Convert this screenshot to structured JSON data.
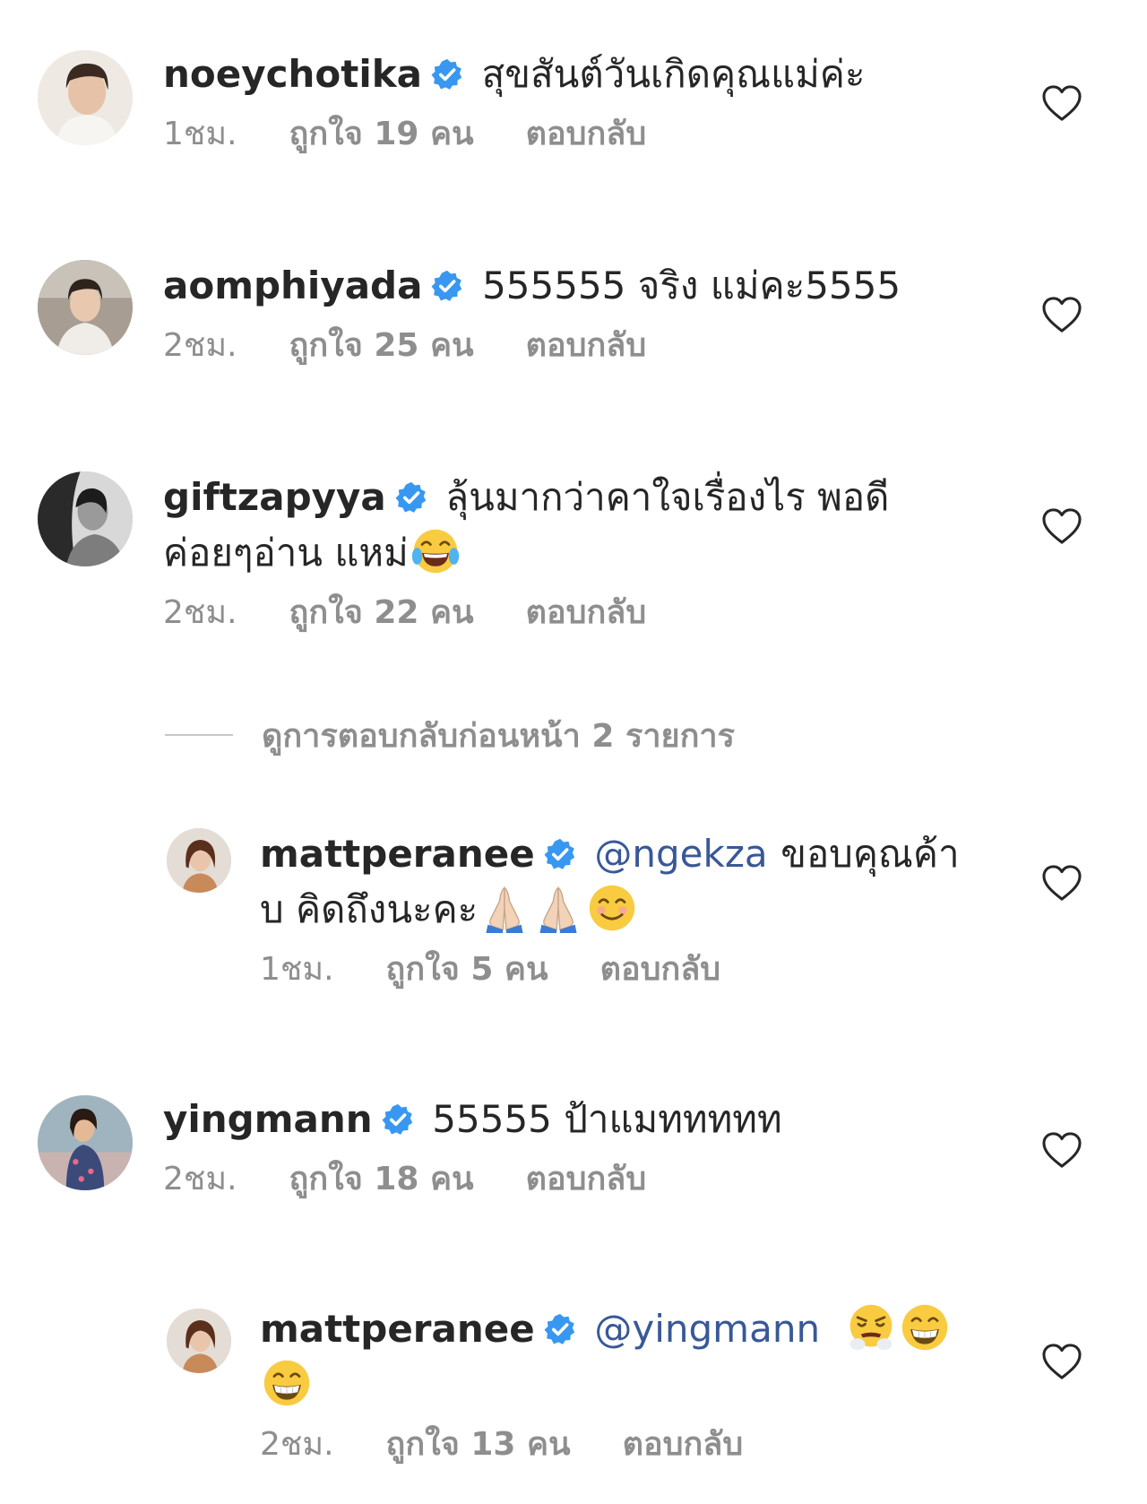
{
  "comments": [
    {
      "username": "noeychotika",
      "line1": "สุขสันต์วันเกิดคุณแม่ค่ะ",
      "time": "1ชม.",
      "likes": "ถูกใจ 19 คน",
      "reply": "ตอบกลับ"
    },
    {
      "username": "aomphiyada",
      "line1": "555555 จริง แม่คะ5555",
      "time": "2ชม.",
      "likes": "ถูกใจ 25 คน",
      "reply": "ตอบกลับ"
    },
    {
      "username": "giftzapyya",
      "line1": "ลุ้นมากว่าคาใจเรื่องไร พอดี",
      "line2": "ค่อยๆอ่าน แหม่",
      "time": "2ชม.",
      "likes": "ถูกใจ 22 คน",
      "reply": "ตอบกลับ"
    },
    {
      "username": "mattperanee",
      "mention": "@ngekza",
      "line1": "ขอบคุณค้า",
      "line2": "บ คิดถึงนะคะ",
      "time": "1ชม.",
      "likes": "ถูกใจ 5 คน",
      "reply": "ตอบกลับ"
    },
    {
      "username": "yingmann",
      "line1": "55555 ป้าแมททททท",
      "time": "2ชม.",
      "likes": "ถูกใจ 18 คน",
      "reply": "ตอบกลับ"
    },
    {
      "username": "mattperanee",
      "mention": "@yingmann",
      "time": "2ชม.",
      "likes": "ถูกใจ 13 คน",
      "reply": "ตอบกลับ"
    }
  ],
  "view_previous_replies": "ดูการตอบกลับก่อนหน้า 2 รายการ",
  "icons": {
    "verified": "verified-badge-icon",
    "like": "heart-outline-icon",
    "emoji_tears_of_joy": "face-with-tears-of-joy",
    "emoji_folded_hands": "folded-hands",
    "emoji_smiling": "smiling-face",
    "emoji_steam": "face-with-steam-from-nose",
    "emoji_grinning": "grinning-face"
  },
  "colors": {
    "text": "#262626",
    "meta": "#8e8e8e",
    "verified_blue": "#3897f0",
    "mention": "#385898"
  }
}
